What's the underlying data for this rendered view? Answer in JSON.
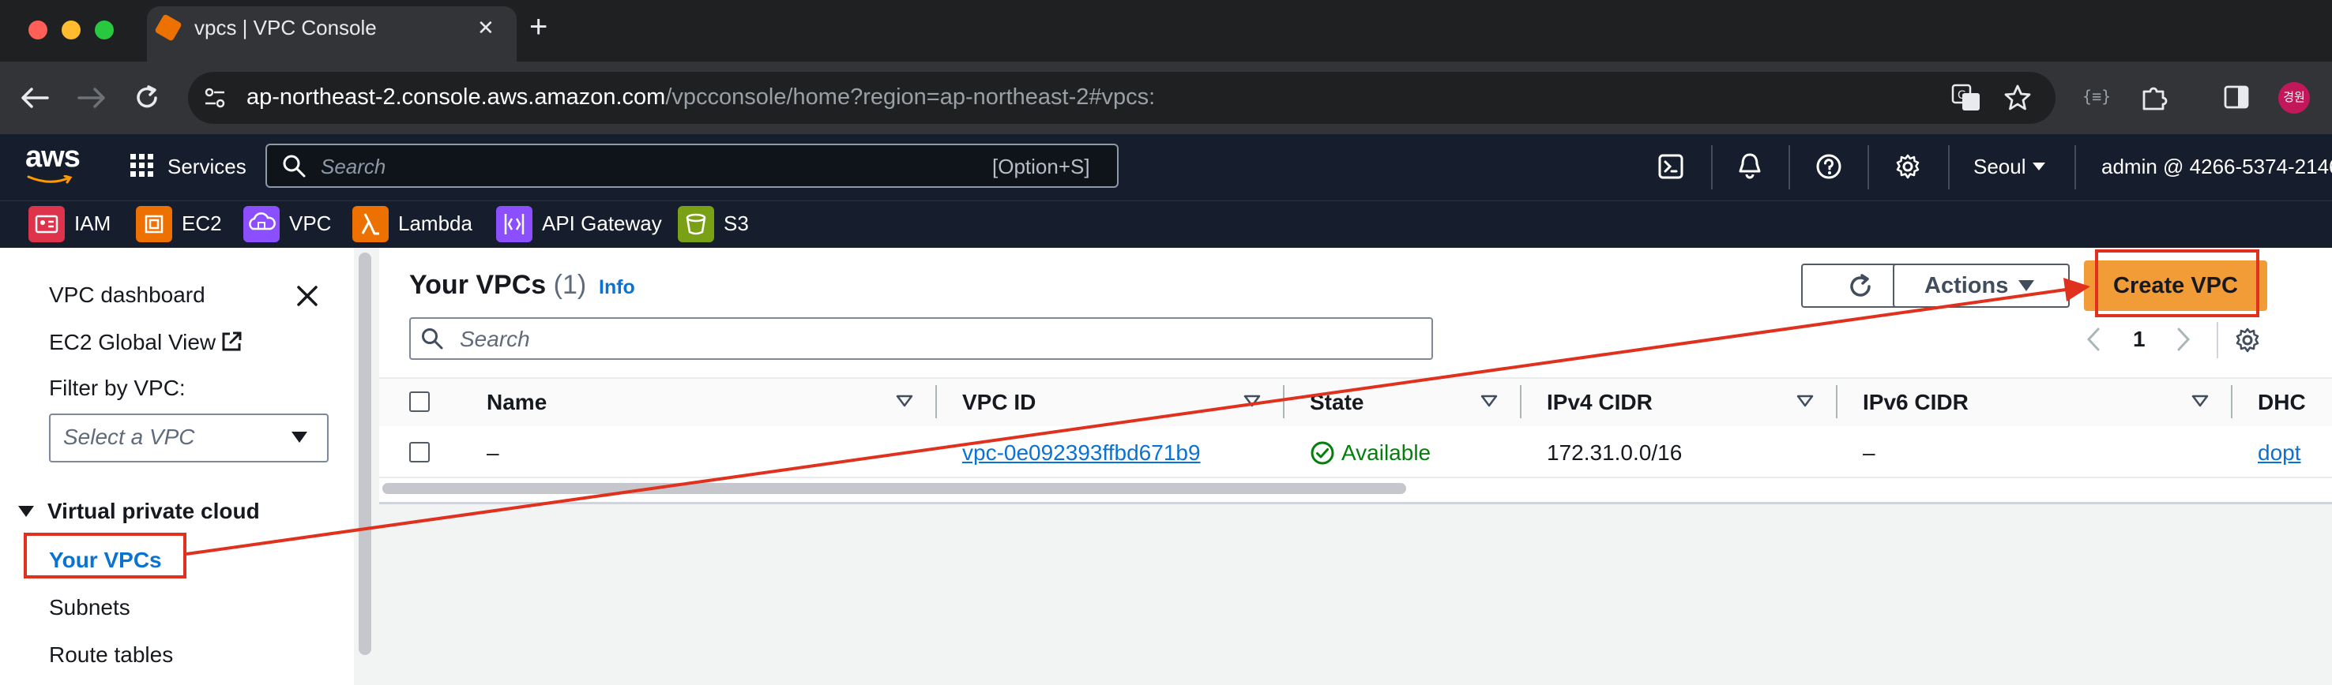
{
  "browser": {
    "tab_title": "vpcs | VPC Console",
    "new_tab_symbol": "+",
    "close_tab_symbol": "✕",
    "url_host": "ap-northeast-2.console.aws.amazon.com",
    "url_path": "/vpcconsole/home?region=ap-northeast-2#vpcs:",
    "profile_initials": "경원"
  },
  "aws_header": {
    "logo": "aws",
    "services_label": "Services",
    "search_placeholder": "Search",
    "search_shortcut": "[Option+S]",
    "region": "Seoul",
    "account": "admin @ 4266-5374-2146"
  },
  "favorites": [
    {
      "label": "IAM",
      "color": "#dd344c"
    },
    {
      "label": "EC2",
      "color": "#ed7100"
    },
    {
      "label": "VPC",
      "color": "#8c4fff"
    },
    {
      "label": "Lambda",
      "color": "#ed7100"
    },
    {
      "label": "API Gateway",
      "color": "#8c4fff"
    },
    {
      "label": "S3",
      "color": "#7aa116"
    }
  ],
  "sidebar": {
    "vpc_dashboard": "VPC dashboard",
    "ec2_global_view": "EC2 Global View",
    "filter_label": "Filter by VPC:",
    "filter_placeholder": "Select a VPC",
    "section_title": "Virtual private cloud",
    "items": [
      "Your VPCs",
      "Subnets",
      "Route tables"
    ]
  },
  "main": {
    "title": "Your VPCs",
    "count": "(1)",
    "info_label": "Info",
    "actions_label": "Actions",
    "create_label": "Create VPC",
    "search_placeholder": "Search",
    "page_number": "1",
    "columns": [
      "Name",
      "VPC ID",
      "State",
      "IPv4 CIDR",
      "IPv6 CIDR",
      "DHC"
    ],
    "rows": [
      {
        "name": "–",
        "vpc_id": "vpc-0e092393ffbd671b9",
        "state": "Available",
        "ipv4": "172.31.0.0/16",
        "ipv6": "–",
        "dhcp": "dopt"
      }
    ]
  },
  "colors": {
    "aws_header": "#161e2d",
    "create_button": "#f29c38",
    "link": "#0972d3",
    "available": "#037f0c",
    "annotation": "#e0301e"
  }
}
